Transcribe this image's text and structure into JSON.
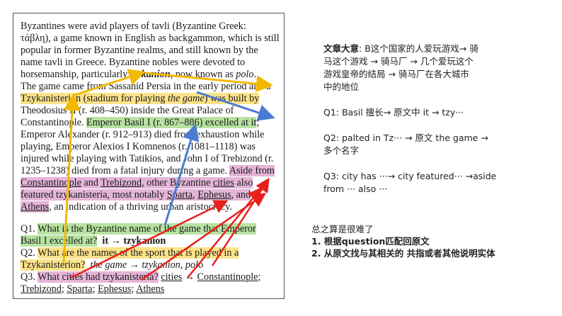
{
  "document": {
    "lines": [
      [
        "Byzantines were avid players of tavli (Byzantine Greek:"
      ],
      [
        "τάβλη), a game known in English as backgammon, which is still"
      ],
      [
        "popular in former Byzantine realms, and still known by the"
      ],
      [
        "name tavli in Greece. Byzantine nobles were devoted to"
      ],
      [
        "horsemanship, particularly ",
        "tzykanion",
        ", now known as ",
        "polo",
        "."
      ],
      [
        "The game came from Sassanid Persia in the early period and a"
      ],
      [
        "Tzykanisterion (stadium for playing ",
        "the game",
        ") was built by"
      ],
      [
        "Theodosius II (r. 408–450) inside the Great Palace of"
      ],
      [
        "Constantinople. ",
        "Emperor Basil I (r. 867–886) excelled at it",
        ";"
      ],
      [
        "Emperor Alexander (r. 912–913) died from exhaustion while"
      ],
      [
        "playing, Emperor Alexios I Komnenos (r. 1081–1118) was"
      ],
      [
        "injured while playing with Tatikios, and John I of Trebizond (r."
      ],
      [
        "1235–1238) died from a fatal injury during a game. ",
        "Aside from"
      ],
      [
        "Constantinople",
        " and ",
        "Trebizond",
        ", other Byzantine ",
        "cities",
        " also"
      ],
      [
        "featured tzykanisteria, most notably ",
        "Sparta",
        ", ",
        "Ephesus",
        ", and"
      ],
      [
        "Athens",
        ", an indication of a thriving urban aristocracy."
      ]
    ],
    "q1": [
      "Q1. ",
      "What is the Byzantine name of the game that Emperor",
      "Basil I excelled at?",
      "it → tzykanion"
    ],
    "q2": [
      "Q2. ",
      "What are the names of the sport that is played in a",
      "Tzykanisterion?",
      "the game → tzykanion, polo"
    ],
    "q3": [
      "Q3. ",
      "What cities had tzykanisteria?",
      "cities",
      " → ",
      "Constantinople",
      ";",
      "Trebizond",
      "; ",
      "Sparta",
      "; ",
      "Ephesus",
      "; ",
      "Athens"
    ]
  },
  "notes": {
    "summary_label": "文章大意",
    "summary_text": ": B这个国家的人爱玩游戏→ 骑",
    "summary_lines": [
      "马这个游戏 → 骑马厂 → 几个爱玩这个",
      "游戏皇帝的结局 → 骑马厂在各大城市",
      "中的地位"
    ],
    "q1": "Q1:  Basil 擅长→ 原文中 it → tzy···",
    "q2_lines": [
      "Q2: palted in Tz··· → 原文 the game →",
      "多个名字"
    ],
    "q3_lines": [
      "Q3: city has ···→ city featured··· →aside",
      "from  ···  also  ···"
    ]
  },
  "conclusion": {
    "title": "总之算是很难了",
    "items": [
      "1. 根据question匹配回原文",
      "2. 从原文找与其相关的 共指或者其他说明实体"
    ]
  },
  "colors": {
    "green_highlight": "#b7e2a1",
    "yellow_highlight": "#fbe38a",
    "pink_highlight": "#e4b5d8",
    "arrow_yellow": "#f5b800",
    "arrow_blue": "#4a7bd0",
    "arrow_red": "#e8201a"
  }
}
